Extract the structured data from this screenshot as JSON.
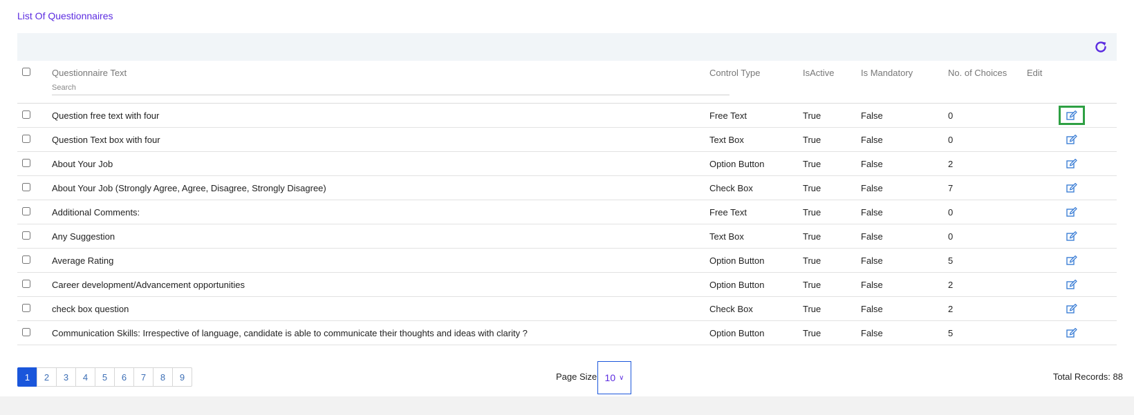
{
  "page": {
    "title": "List Of Questionnaires"
  },
  "colors": {
    "accent": "#5b2be0",
    "primary": "#1a56db",
    "edit_icon": "#3d7fd6",
    "focus": "#2ea043"
  },
  "toolbar": {
    "refresh_icon": "refresh-icon"
  },
  "table": {
    "headers": {
      "text": "Questionnaire Text",
      "control": "Control Type",
      "active": "IsActive",
      "mandatory": "Is Mandatory",
      "choices": "No. of Choices",
      "edit": "Edit"
    },
    "search": {
      "placeholder": "Search",
      "value": ""
    },
    "rows": [
      {
        "text": "Question free text with four",
        "control": "Free Text",
        "active": "True",
        "mandatory": "False",
        "choices": "0"
      },
      {
        "text": "Question Text box with four",
        "control": "Text Box",
        "active": "True",
        "mandatory": "False",
        "choices": "0"
      },
      {
        "text": "About Your Job",
        "control": "Option Button",
        "active": "True",
        "mandatory": "False",
        "choices": "2"
      },
      {
        "text": "About Your Job (Strongly Agree, Agree, Disagree, Strongly Disagree)",
        "control": "Check Box",
        "active": "True",
        "mandatory": "False",
        "choices": "7"
      },
      {
        "text": "Additional Comments:",
        "control": "Free Text",
        "active": "True",
        "mandatory": "False",
        "choices": "0"
      },
      {
        "text": "Any Suggestion",
        "control": "Text Box",
        "active": "True",
        "mandatory": "False",
        "choices": "0"
      },
      {
        "text": "Average Rating",
        "control": "Option Button",
        "active": "True",
        "mandatory": "False",
        "choices": "5"
      },
      {
        "text": "Career development/Advancement opportunities",
        "control": "Option Button",
        "active": "True",
        "mandatory": "False",
        "choices": "2"
      },
      {
        "text": "check box question",
        "control": "Check Box",
        "active": "True",
        "mandatory": "False",
        "choices": "2"
      },
      {
        "text": "Communication Skills: Irrespective of language, candidate is able to communicate their thoughts and ideas with clarity ?",
        "control": "Option Button",
        "active": "True",
        "mandatory": "False",
        "choices": "5"
      }
    ]
  },
  "pagination": {
    "pages": [
      "1",
      "2",
      "3",
      "4",
      "5",
      "6",
      "7",
      "8",
      "9"
    ],
    "page_size_label": "Page Size:",
    "page_size": "10",
    "total_label": "Total Records: 88"
  }
}
